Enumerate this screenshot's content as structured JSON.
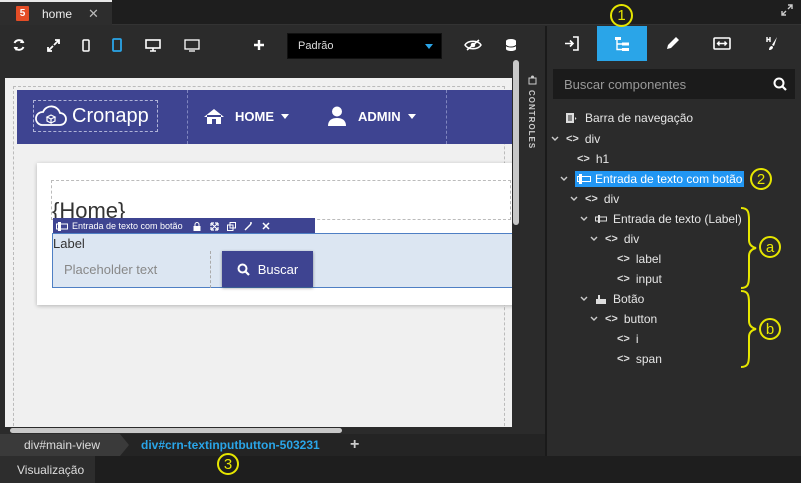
{
  "tab": {
    "title": "home",
    "close": "✕"
  },
  "toolbar": {
    "device_select": "Padrão"
  },
  "controles_label": "CONTROLES",
  "navbar": {
    "logo": "Cronapp",
    "items": [
      {
        "label": "HOME"
      },
      {
        "label": "ADMIN"
      }
    ]
  },
  "page": {
    "heading": "{Home}",
    "component_toolbar": "Entrada de texto com botão",
    "label": "Label",
    "input_placeholder": "Placeholder text",
    "button_label": "Buscar"
  },
  "breadcrumb": [
    "div#main-view",
    "div#crn-textinputbutton-503231"
  ],
  "breadcrumb_add": "+",
  "bottom_tab": "Visualização",
  "search": {
    "placeholder": "Buscar componentes"
  },
  "tree": [
    {
      "label": "Barra de navegação"
    },
    {
      "label": "div"
    },
    {
      "label": "h1"
    },
    {
      "label": "Entrada de texto com botão"
    },
    {
      "label": "div"
    },
    {
      "label": "Entrada de texto (Label)"
    },
    {
      "label": "div"
    },
    {
      "label": "label"
    },
    {
      "label": "input"
    },
    {
      "label": "Botão"
    },
    {
      "label": "button"
    },
    {
      "label": "i"
    },
    {
      "label": "span"
    }
  ],
  "annotations": {
    "a1": "1",
    "a2": "2",
    "a3": "3",
    "a": "a",
    "b": "b"
  },
  "colors": {
    "accent": "#2aa5e8",
    "navbar": "#3e4491",
    "annotation": "#e6e600"
  }
}
